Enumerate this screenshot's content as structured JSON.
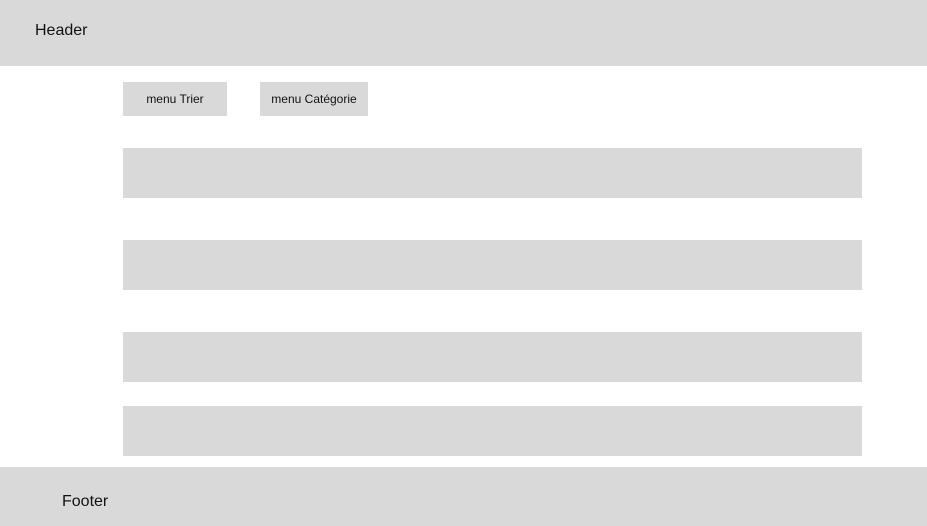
{
  "header": {
    "title": "Header"
  },
  "toolbar": {
    "sort_menu_label": "menu Trier",
    "category_menu_label": "menu Catégorie"
  },
  "footer": {
    "title": "Footer"
  },
  "colors": {
    "placeholder_gray": "#d9d9d9",
    "background": "#ffffff",
    "text": "#111111"
  }
}
